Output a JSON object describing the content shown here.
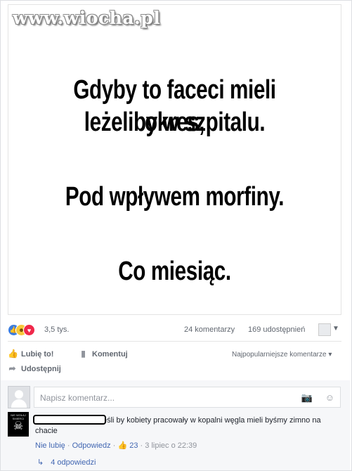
{
  "watermark": "www.wiocha.pl",
  "meme": {
    "lines": [
      "Gdyby to faceci mieli okres,",
      "leżeliby w szpitalu.",
      "Pod wpływem morfiny.",
      "Co miesiąc."
    ]
  },
  "stats": {
    "reactions": "3,5 tys.",
    "comments": "24 komentarzy",
    "shares": "169 udostępnień"
  },
  "actions": {
    "like": "Lubię to!",
    "comment": "Komentuj",
    "share": "Udostępnij",
    "sort": "Najpopularniejsze komentarze"
  },
  "composer": {
    "placeholder": "Napisz komentarz..."
  },
  "comment": {
    "text": "eśli by kobiety pracowały w kopalni węgla mieli byśmy zimno na chacie",
    "avatar_label": "NIE WOŁAJ SMIERCI",
    "unlike": "Nie lubię",
    "reply": "Odpowiedz",
    "likes": "23",
    "date": "3 lipiec o 22:39",
    "replies": "4 odpowiedzi"
  },
  "colors": {
    "link": "#4267b2",
    "muted": "#90949c",
    "like_reaction": "#3b7de0",
    "haha_reaction": "#f7c83a",
    "love_reaction": "#f0284a"
  },
  "icons": [
    "like-reaction-icon",
    "haha-reaction-icon",
    "love-reaction-icon",
    "thumbs-up-icon",
    "comment-icon",
    "share-icon",
    "camera-icon",
    "emoji-icon",
    "reply-arrow-icon"
  ]
}
